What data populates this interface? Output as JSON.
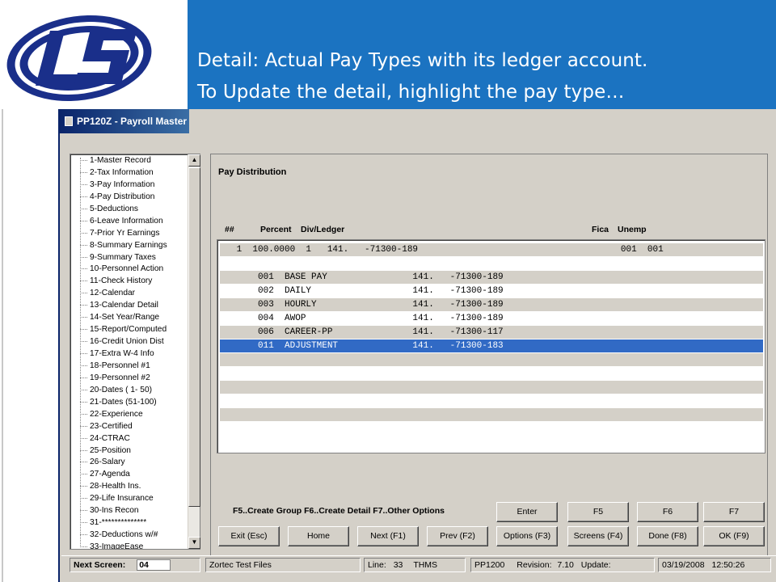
{
  "banner": {
    "line1": "Detail:  Actual Pay Types with its ledger account.",
    "line2": "To Update the detail, highlight the pay type…"
  },
  "window": {
    "title": "PP120Z - Payroll Master"
  },
  "tree": {
    "items": [
      "1-Master Record",
      "2-Tax Information",
      "3-Pay Information",
      "4-Pay Distribution",
      "5-Deductions",
      "6-Leave Information",
      "7-Prior Yr Earnings",
      "8-Summary Earnings",
      "9-Summary Taxes",
      "10-Personnel Action",
      "11-Check History",
      "12-Calendar",
      "13-Calendar Detail",
      "14-Set Year/Range",
      "15-Report/Computed",
      "16-Credit Union Dist",
      "17-Extra W-4 Info",
      "18-Personnel #1",
      "19-Personnel #2",
      "20-Dates ( 1- 50)",
      "21-Dates (51-100)",
      "22-Experience",
      "23-Certified",
      "24-CTRAC",
      "25-Position",
      "26-Salary",
      "27-Agenda",
      "28-Health Ins.",
      "29-Life Insurance",
      "30-Ins Recon",
      "31-**************",
      "32-Deductions w/#",
      "33-ImageEase"
    ]
  },
  "panel": {
    "title": "Pay Distribution",
    "headers": {
      "num": "##",
      "percent": "Percent",
      "div_ledger": "Div/Ledger",
      "fica": "Fica",
      "unemp": "Unemp"
    },
    "rows": [
      " 1  100.0000  1   141.   -71300-189                                      001  001",
      "",
      "     001  BASE PAY                141.   -71300-189",
      "     002  DAILY                   141.   -71300-189",
      "     003  HOURLY                  141.   -71300-189",
      "     004  AWOP                    141.   -71300-189",
      "     006  CAREER-PP               141.   -71300-117",
      "     011  ADJUSTMENT              141.   -71300-183",
      "",
      "",
      "",
      "",
      "",
      ""
    ],
    "hint": "F5..Create Group  F6..Create Detail  F7..Other Options"
  },
  "buttons": {
    "enter": "Enter",
    "f5": "F5",
    "f6": "F6",
    "f7": "F7",
    "exit": "Exit (Esc)",
    "home": "Home",
    "next": "Next (F1)",
    "prev": "Prev (F2)",
    "options": "Options (F3)",
    "screens": "Screens (F4)",
    "done": "Done (F8)",
    "ok": "OK (F9)"
  },
  "statusbar": {
    "next_screen_label": "Next Screen:",
    "next_screen_value": "04",
    "company": "Zortec Test Files",
    "line_label": "Line:",
    "line_value": "33",
    "user": "THMS",
    "program": "PP1200",
    "revision_label": "Revision:",
    "revision_value": "7.10",
    "update_label": "Update:",
    "date": "03/19/2008",
    "time": "12:50:26"
  },
  "colors": {
    "banner": "#1b73c1",
    "selection": "#316ac5",
    "logo": "#1a2f8a"
  }
}
